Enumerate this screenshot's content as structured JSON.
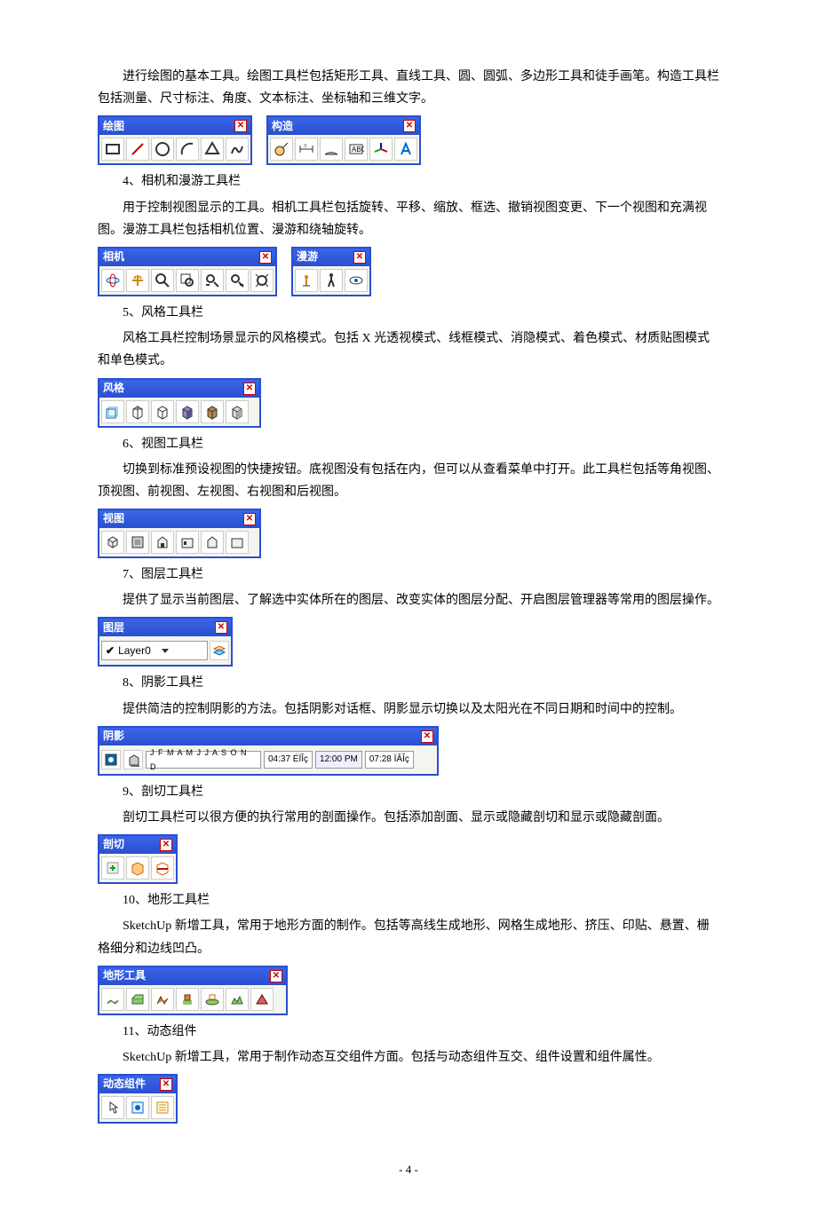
{
  "paragraphs": {
    "intro1": "进行绘图的基本工具。绘图工具栏包括矩形工具、直线工具、圆、圆弧、多边形工具和徒手画笔。构造工具栏包括测量、尺寸标注、角度、文本标注、坐标轴和三维文字。",
    "section4_title": "4、相机和漫游工具栏",
    "section4_body": "用于控制视图显示的工具。相机工具栏包括旋转、平移、缩放、框选、撤销视图变更、下一个视图和充满视图。漫游工具栏包括相机位置、漫游和绕轴旋转。",
    "section5_title": "5、风格工具栏",
    "section5_body": "风格工具栏控制场景显示的风格模式。包括 X 光透视模式、线框模式、消隐模式、着色模式、材质贴图模式和单色模式。",
    "section6_title": "6、视图工具栏",
    "section6_body": "切换到标准预设视图的快捷按钮。底视图没有包括在内，但可以从查看菜单中打开。此工具栏包括等角视图、顶视图、前视图、左视图、右视图和后视图。",
    "section7_title": "7、图层工具栏",
    "section7_body": "提供了显示当前图层、了解选中实体所在的图层、改变实体的图层分配、开启图层管理器等常用的图层操作。",
    "section8_title": "8、阴影工具栏",
    "section8_body": "提供简洁的控制阴影的方法。包括阴影对话框、阴影显示切换以及太阳光在不同日期和时间中的控制。",
    "section9_title": "9、剖切工具栏",
    "section9_body": "剖切工具栏可以很方便的执行常用的剖面操作。包括添加剖面、显示或隐藏剖切和显示或隐藏剖面。",
    "section10_title": "10、地形工具栏",
    "section10_body": "SketchUp 新增工具，常用于地形方面的制作。包括等高线生成地形、网格生成地形、挤压、印贴、悬置、栅格细分和边线凹凸。",
    "section11_title": "11、动态组件",
    "section11_body": "SketchUp 新增工具，常用于制作动态互交组件方面。包括与动态组件互交、组件设置和组件属性。"
  },
  "toolbars": {
    "draw": {
      "title": "绘图"
    },
    "construct": {
      "title": "构造"
    },
    "camera": {
      "title": "相机"
    },
    "walk": {
      "title": "漫游"
    },
    "style": {
      "title": "风格"
    },
    "view": {
      "title": "视图"
    },
    "layer": {
      "title": "图层",
      "current": "Layer0"
    },
    "shadow": {
      "title": "阴影",
      "months": "J F M A M J J A S O N D",
      "time1": "04:37 ÉÏÎç",
      "time2": "12:00 PM",
      "time3": "07:28 ÏÂÎç"
    },
    "section": {
      "title": "剖切"
    },
    "terrain": {
      "title": "地形工具"
    },
    "dynamic": {
      "title": "动态组件"
    }
  },
  "page_number": "- 4 -"
}
